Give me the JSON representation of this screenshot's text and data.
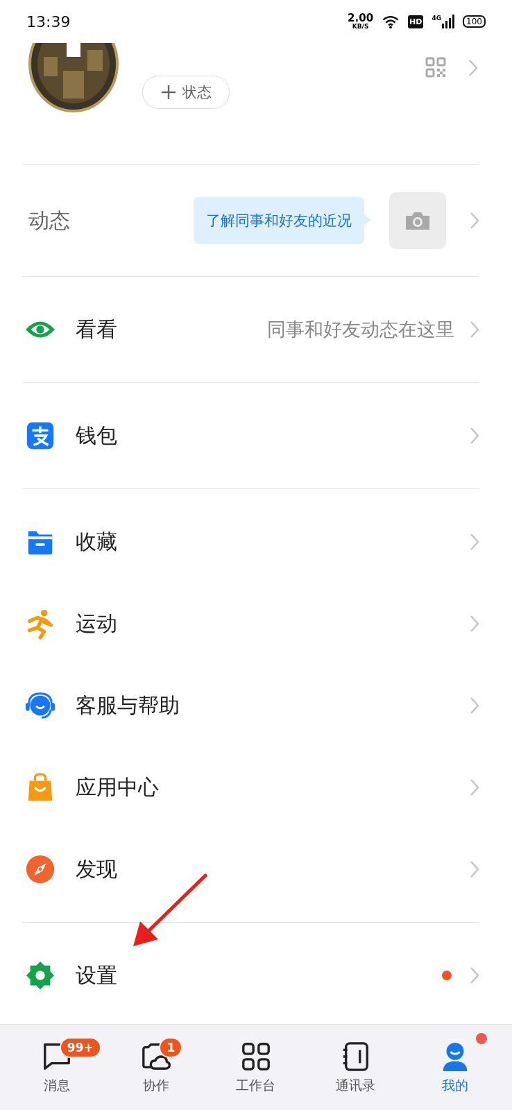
{
  "status_bar": {
    "time": "13:39",
    "speed": "2.00",
    "speed_unit": "KB/S",
    "hd": "HD",
    "network": "4G",
    "battery": "100"
  },
  "profile": {
    "status_button": {
      "label": "状态"
    }
  },
  "moments": {
    "label": "动态",
    "hint": "了解同事和好友的近况"
  },
  "groups": [
    [
      {
        "kind": "eye",
        "label": "看看",
        "subtitle": "同事和好友动态在这里",
        "dot": false
      }
    ],
    [
      {
        "kind": "wallet",
        "label": "钱包",
        "dot": false
      }
    ],
    [
      {
        "kind": "folder",
        "label": "收藏",
        "dot": false
      },
      {
        "kind": "runner",
        "label": "运动",
        "dot": false
      },
      {
        "kind": "support",
        "label": "客服与帮助",
        "dot": false
      },
      {
        "kind": "bag",
        "label": "应用中心",
        "dot": false
      },
      {
        "kind": "compass",
        "label": "发现",
        "dot": false
      }
    ],
    [
      {
        "kind": "gear",
        "label": "设置",
        "dot": true
      }
    ]
  ],
  "tab_bar": [
    {
      "kind": "chat",
      "label": "消息",
      "badge": "99+",
      "selected": false,
      "dot": false
    },
    {
      "kind": "cowork",
      "label": "协作",
      "badge": "1",
      "selected": false,
      "dot": false
    },
    {
      "kind": "grid",
      "label": "工作台",
      "selected": false,
      "dot": false
    },
    {
      "kind": "book",
      "label": "通讯录",
      "selected": false,
      "dot": false
    },
    {
      "kind": "person",
      "label": "我的",
      "selected": true,
      "dot": true
    }
  ]
}
